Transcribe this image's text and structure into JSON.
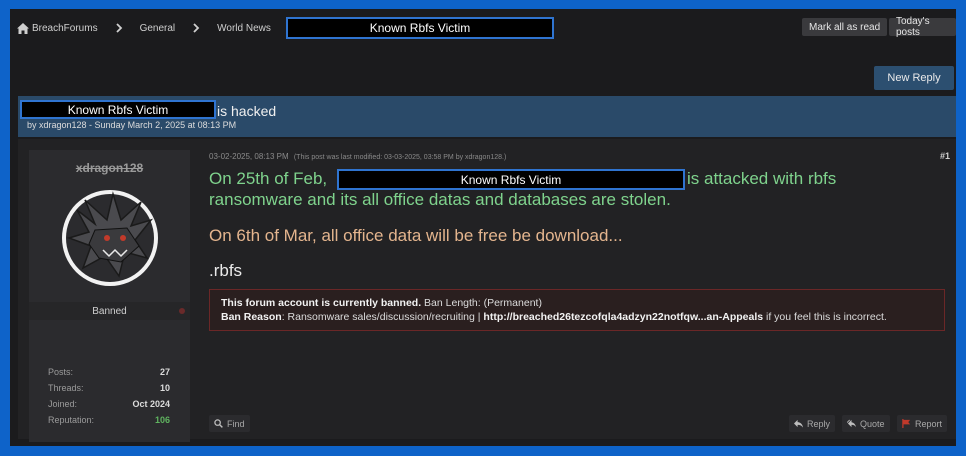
{
  "nav": {
    "home_label": "BreachForums",
    "crumbs": [
      "General",
      "World News"
    ],
    "redacted_title": "Known Rbfs Victim",
    "mark_all_read": "Mark all as read",
    "todays_posts": "Today's posts"
  },
  "new_reply": "New Reply",
  "thread": {
    "redacted_name": "Known Rbfs Victim",
    "title_suffix": "is hacked",
    "byline": "by xdragon128 - Sunday March 2, 2025 at 08:13 PM"
  },
  "author": {
    "username": "xdragon128",
    "status": "Banned",
    "stats": [
      {
        "label": "Posts:",
        "value": "27"
      },
      {
        "label": "Threads:",
        "value": "10"
      },
      {
        "label": "Joined:",
        "value": "Oct 2024"
      },
      {
        "label": "Reputation:",
        "value": "106"
      }
    ]
  },
  "post": {
    "date": "03-02-2025, 08:13 PM",
    "modified": "(This post was last modified: 03-03-2025, 03:58 PM by xdragon128.)",
    "number": "#1",
    "line1_start": "On 25th of Feb,",
    "redacted_name": "Known Rbfs Victim",
    "line1_end": "is attacked with rbfs",
    "line2": "ransomware and its all office datas and databases are stolen.",
    "line3": "On 6th of Mar, all office data will be free be download...",
    "line4": ".rbfs"
  },
  "ban_notice": {
    "bold1": "This forum account is currently banned.",
    "length": " Ban Length: (Permanent)",
    "reason_label": "Ban Reason",
    "reason_text": ": Ransomware sales/discussion/recruiting | ",
    "link": "http://breached26tezcofqla4adzyn22notfqw...an-Appeals",
    "suffix": " if you feel this is incorrect."
  },
  "actions": {
    "find": "Find",
    "reply": "Reply",
    "quote": "Quote",
    "report": "Report"
  },
  "colors": {
    "outer_border": "#0e63c9",
    "thread_header": "#2a4a69",
    "green_text": "#7fd38d",
    "peach_text": "#e4b58e",
    "reputation": "#5fb35f",
    "ban_border": "#6b2727"
  }
}
